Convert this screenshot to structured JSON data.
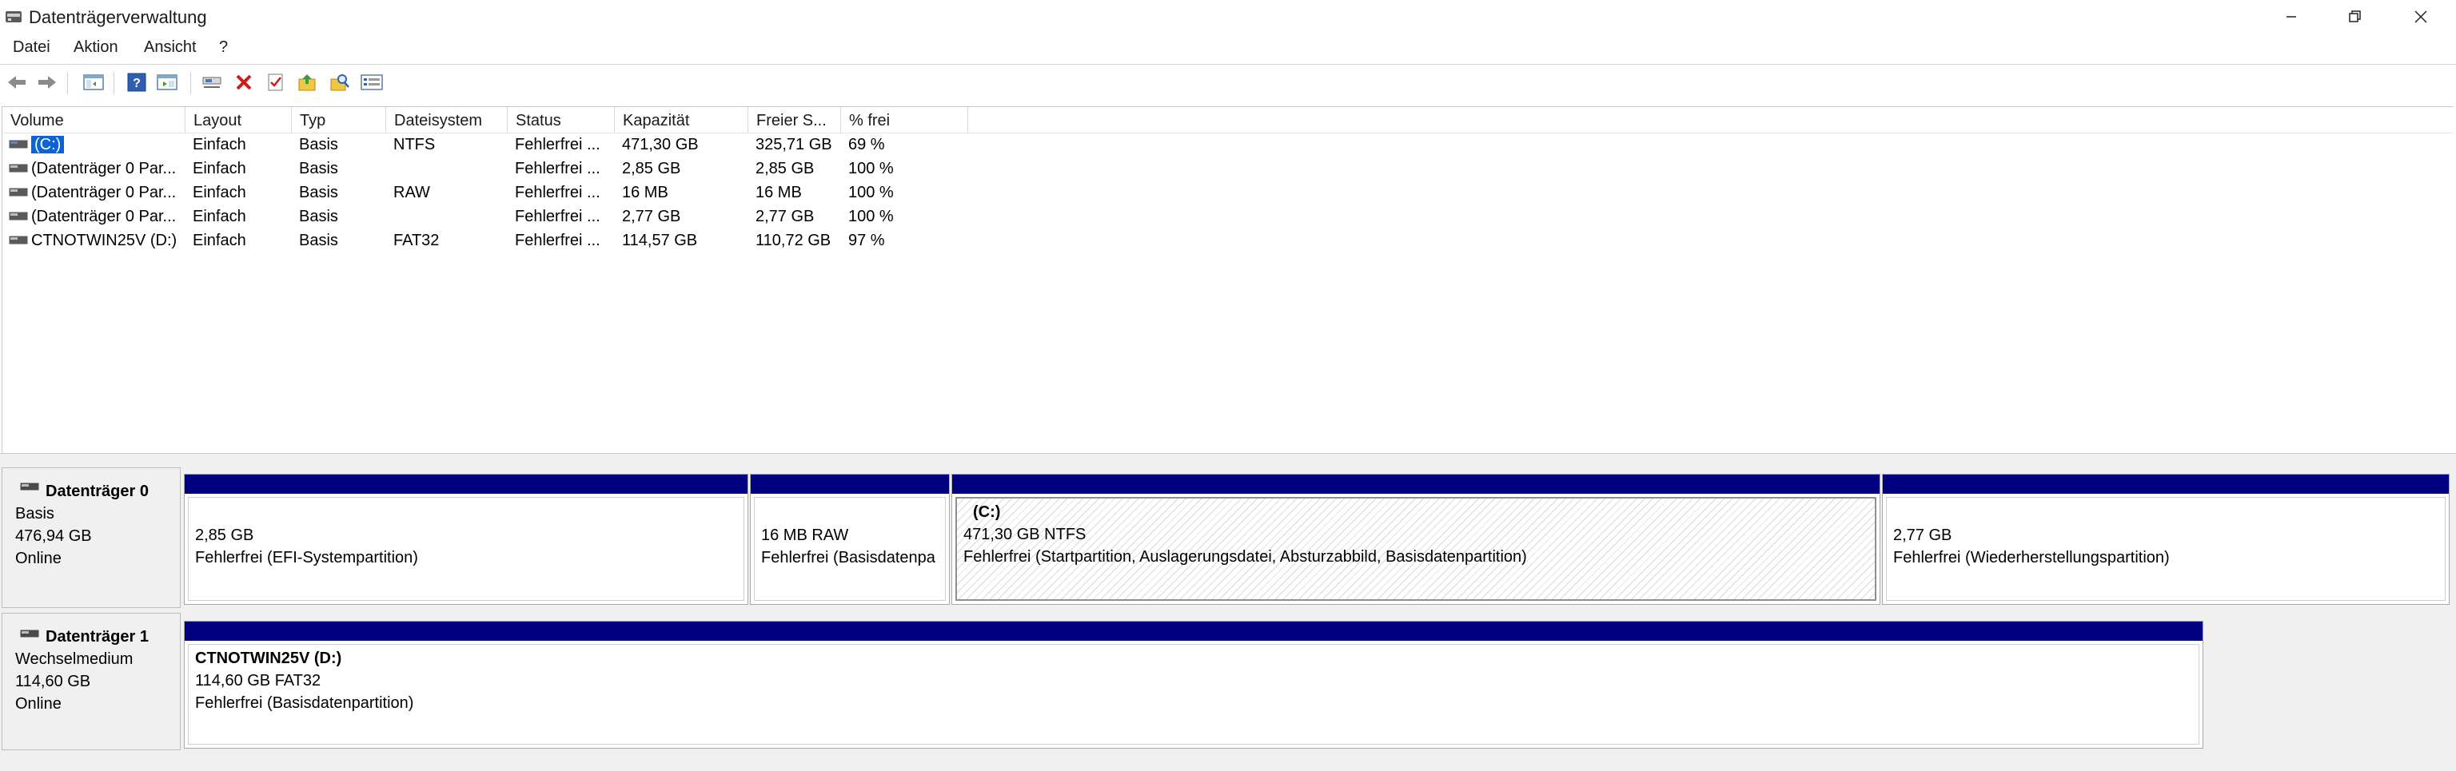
{
  "window": {
    "title": "Datenträgerverwaltung"
  },
  "menu": [
    "Datei",
    "Aktion",
    "Ansicht",
    "?"
  ],
  "toolbar": [
    "back-icon",
    "forward-icon",
    "console-tree-icon",
    "help-icon",
    "properties-list-icon",
    "connect-icon",
    "delete-icon",
    "check-icon",
    "folder-up-icon",
    "search-folder-icon",
    "settings-list-icon"
  ],
  "list": {
    "columns": [
      "Volume",
      "Layout",
      "Typ",
      "Dateisystem",
      "Status",
      "Kapazität",
      "Freier S...",
      "% frei"
    ],
    "rows": [
      {
        "volume": "(C:)",
        "layout": "Einfach",
        "typ": "Basis",
        "fs": "NTFS",
        "status": "Fehlerfrei ...",
        "cap": "471,30 GB",
        "free": "325,71 GB",
        "pct": "69 %",
        "selected": true
      },
      {
        "volume": "(Datenträger 0 Par...",
        "layout": "Einfach",
        "typ": "Basis",
        "fs": "",
        "status": "Fehlerfrei ...",
        "cap": "2,85 GB",
        "free": "2,85 GB",
        "pct": "100 %"
      },
      {
        "volume": "(Datenträger 0 Par...",
        "layout": "Einfach",
        "typ": "Basis",
        "fs": "RAW",
        "status": "Fehlerfrei ...",
        "cap": "16 MB",
        "free": "16 MB",
        "pct": "100 %"
      },
      {
        "volume": "(Datenträger 0 Par...",
        "layout": "Einfach",
        "typ": "Basis",
        "fs": "",
        "status": "Fehlerfrei ...",
        "cap": "2,77 GB",
        "free": "2,77 GB",
        "pct": "100 %"
      },
      {
        "volume": "CTNOTWIN25V (D:)",
        "layout": "Einfach",
        "typ": "Basis",
        "fs": "FAT32",
        "status": "Fehlerfrei ...",
        "cap": "114,57 GB",
        "free": "110,72 GB",
        "pct": "97 %"
      }
    ]
  },
  "disks": [
    {
      "name": "Datenträger 0",
      "type": "Basis",
      "size": "476,94 GB",
      "state": "Online",
      "partitions": [
        {
          "title": "",
          "line1": "2,85 GB",
          "line2": "Fehlerfrei (EFI-Systempartition)"
        },
        {
          "title": "",
          "line1": "16 MB RAW",
          "line2": "Fehlerfrei (Basisdatenpa"
        },
        {
          "title": "(C:)",
          "line1": "471,30 GB NTFS",
          "line2": "Fehlerfrei (Startpartition, Auslagerungsdatei, Absturzabbild, Basisdatenpartition)"
        },
        {
          "title": "",
          "line1": "2,77 GB",
          "line2": "Fehlerfrei (Wiederherstellungspartition)"
        }
      ]
    },
    {
      "name": "Datenträger 1",
      "type": "Wechselmedium",
      "size": "114,60 GB",
      "state": "Online",
      "partitions": [
        {
          "title": "CTNOTWIN25V  (D:)",
          "line1": "114,60 GB FAT32",
          "line2": "Fehlerfrei (Basisdatenpartition)"
        }
      ]
    }
  ],
  "colors": {
    "partition_bar": "#000080",
    "selection": "#0a64d7",
    "pane_bg": "#f0f0f0"
  }
}
